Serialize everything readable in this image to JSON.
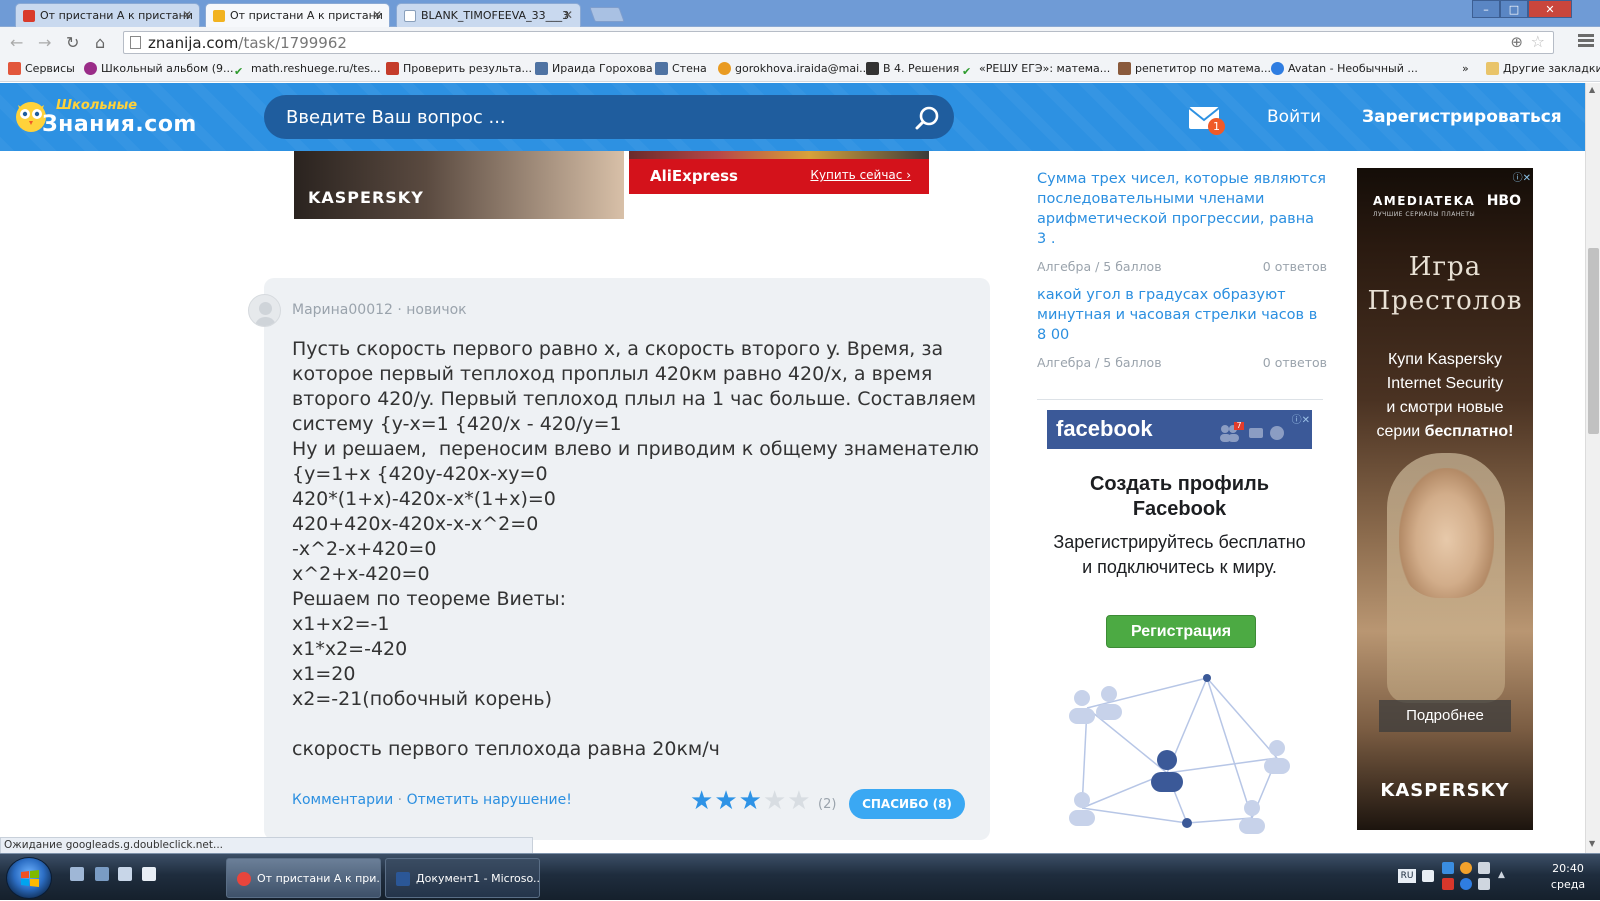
{
  "browser": {
    "tabs": [
      {
        "title": "От пристани А к пристани",
        "active": false,
        "favicon_color": "#d93a2b"
      },
      {
        "title": "От пристани А к пристани",
        "active": true,
        "favicon_color": "#f2b320"
      },
      {
        "title": "BLANK_TIMOFEEVA_33___3",
        "active": false,
        "favicon_color": "#8aa0bb"
      }
    ],
    "window_controls": {
      "minimize": "–",
      "maximize": "□",
      "close": "✕"
    },
    "url_host": "znanija.com",
    "url_path": "/task/1799962",
    "bookmarks": [
      {
        "label": "Сервисы",
        "icon_color": "#e2563b"
      },
      {
        "label": "Школьный альбом (9...",
        "icon_color": "#9a2c88"
      },
      {
        "label": "math.reshuege.ru/tes...",
        "icon_color": "#2e9b2e"
      },
      {
        "label": "Проверить результа...",
        "icon_color": "#c53c2a"
      },
      {
        "label": "Ираида Горохова",
        "icon_color": "#4f73a3"
      },
      {
        "label": "Стена",
        "icon_color": "#4f73a3"
      },
      {
        "label": "gorokhova.iraida@mai...",
        "icon_color": "#e99b22"
      },
      {
        "label": "В 4. Решения",
        "icon_color": "#333333"
      },
      {
        "label": "«РЕШУ ЕГЭ»: матема...",
        "icon_color": "#2e9b2e"
      },
      {
        "label": "репетитор по матема...",
        "icon_color": "#8a5a3c"
      },
      {
        "label": "Avatan - Необычный ...",
        "icon_color": "#2f7de1"
      },
      {
        "label": "»",
        "icon_color": ""
      },
      {
        "label": "Другие закладки",
        "icon_color": "#e9c46a"
      }
    ],
    "status_text": "Ожидание googleads.g.doubleclick.net..."
  },
  "site": {
    "logo_small": "Школьные",
    "logo_big": "Знания.com",
    "search_placeholder": "Введите Ваш вопрос ...",
    "notifications": "1",
    "login": "Войти",
    "register": "Зарегистрироваться",
    "accent": "#2d91e2"
  },
  "ads_top": {
    "kaspersky_logo": "KASPERSKY",
    "ali_logo": "AliExpress",
    "ali_buy": "Купить сейчас ›"
  },
  "answer": {
    "author": "Марина00012",
    "rank": "новичок",
    "text": "Пусть скорость первого равно x, а скорость второго y. Время, за\nкоторое первый теплоход проплыл 420км равно 420/x, а время\nвторого 420/y. Первый теплоход плыл на 1 час больше. Составляем\nсистему {y-x=1 {420/x - 420/y=1\nНу и решаем,  переносим влево и приводим к общему знаменателю\n{y=1+x {420y-420x-xy=0\n420*(1+x)-420x-x*(1+x)=0\n420+420x-420x-x-x^2=0\n-x^2-x+420=0\nx^2+x-420=0\nРешаем по теореме Виеты:\nx1+x2=-1\nx1*x2=-420\nx1=20\nx2=-21(побочный корень)\n\nскорость первого теплохода равна 20км/ч",
    "comments_link": "Комментарии",
    "report_link": "Отметить нарушение!",
    "rating_stars": 3,
    "rating_max": 5,
    "rating_count": "(2)",
    "thanks_button": "СПАСИБО (8)"
  },
  "sidebar_questions": [
    {
      "title": "Сумма трех чисел, которые являются последовательными членами арифметической прогрессии, равна 3 .",
      "subject": "Алгебра",
      "points": "5 баллов",
      "answers": "0 ответов"
    },
    {
      "title": "какой угол в градусах образуют минутная и часовая стрелки часов в 8 00",
      "subject": "Алгебра",
      "points": "5 баллов",
      "answers": "0 ответов"
    }
  ],
  "fb_ad": {
    "brand": "facebook",
    "notif": "7",
    "title": "Создать профиль Facebook",
    "subtitle": "Зарегистрируйтесь бесплатно и подключитесь к миру.",
    "button": "Регистрация",
    "brand_color": "#3b5998"
  },
  "amed_ad": {
    "brand": "AMEDIATEKA",
    "brand_sub": "ЛУЧШИЕ СЕРИАЛЫ ПЛАНЕТЫ",
    "partner": "HBO",
    "show_line1": "Игра",
    "show_line2": "Престолов",
    "promo_line1": "Купи Kaspersky",
    "promo_line2": "Internet Security",
    "promo_line3": "и смотри новые",
    "promo_line4a": "серии ",
    "promo_line4b": "бесплатно!",
    "more_button": "Подробнее",
    "footer": "KASPERSKY"
  },
  "taskbar": {
    "tasks": [
      {
        "label": "От пристани А к при...",
        "active": true,
        "icon_color": "#e8453c"
      },
      {
        "label": "Документ1 - Microso...",
        "active": false,
        "icon_color": "#2b5797"
      }
    ],
    "lang": "RU",
    "time": "20:40",
    "day": "среда"
  }
}
